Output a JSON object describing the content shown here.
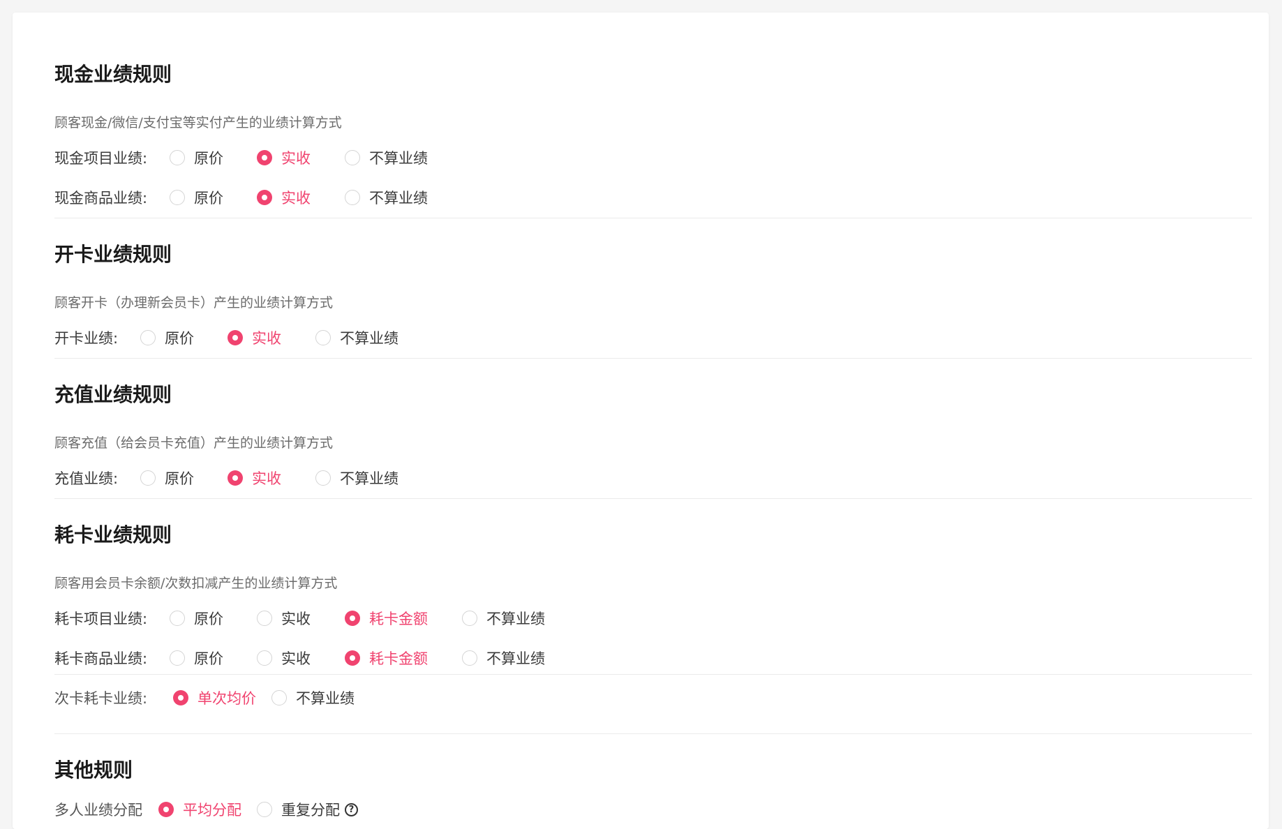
{
  "accent_color": "#f0436f",
  "cash": {
    "title": "现金业绩规则",
    "desc": "顾客现金/微信/支付宝等实付产生的业绩计算方式",
    "project": {
      "label": "现金项目业绩:",
      "options": [
        "原价",
        "实收",
        "不算业绩"
      ],
      "selected": "实收"
    },
    "goods": {
      "label": "现金商品业绩:",
      "options": [
        "原价",
        "实收",
        "不算业绩"
      ],
      "selected": "实收"
    }
  },
  "open_card": {
    "title": "开卡业绩规则",
    "desc": "顾客开卡（办理新会员卡）产生的业绩计算方式",
    "row": {
      "label": "开卡业绩:",
      "options": [
        "原价",
        "实收",
        "不算业绩"
      ],
      "selected": "实收"
    }
  },
  "recharge": {
    "title": "充值业绩规则",
    "desc": "顾客充值（给会员卡充值）产生的业绩计算方式",
    "row": {
      "label": "充值业绩:",
      "options": [
        "原价",
        "实收",
        "不算业绩"
      ],
      "selected": "实收"
    }
  },
  "consume": {
    "title": "耗卡业绩规则",
    "desc": "顾客用会员卡余额/次数扣减产生的业绩计算方式",
    "project": {
      "label": "耗卡项目业绩:",
      "options": [
        "原价",
        "实收",
        "耗卡金额",
        "不算业绩"
      ],
      "selected": "耗卡金额"
    },
    "goods": {
      "label": "耗卡商品业绩:",
      "options": [
        "原价",
        "实收",
        "耗卡金额",
        "不算业绩"
      ],
      "selected": "耗卡金额"
    },
    "times_card": {
      "label": "次卡耗卡业绩:",
      "options": [
        "单次均价",
        "不算业绩"
      ],
      "selected": "单次均价"
    }
  },
  "other": {
    "title": "其他规则",
    "multi": {
      "label": "多人业绩分配",
      "options": [
        "平均分配",
        "重复分配"
      ],
      "selected": "平均分配",
      "help_icon": "question-circle-icon",
      "help_glyph": "?"
    }
  }
}
